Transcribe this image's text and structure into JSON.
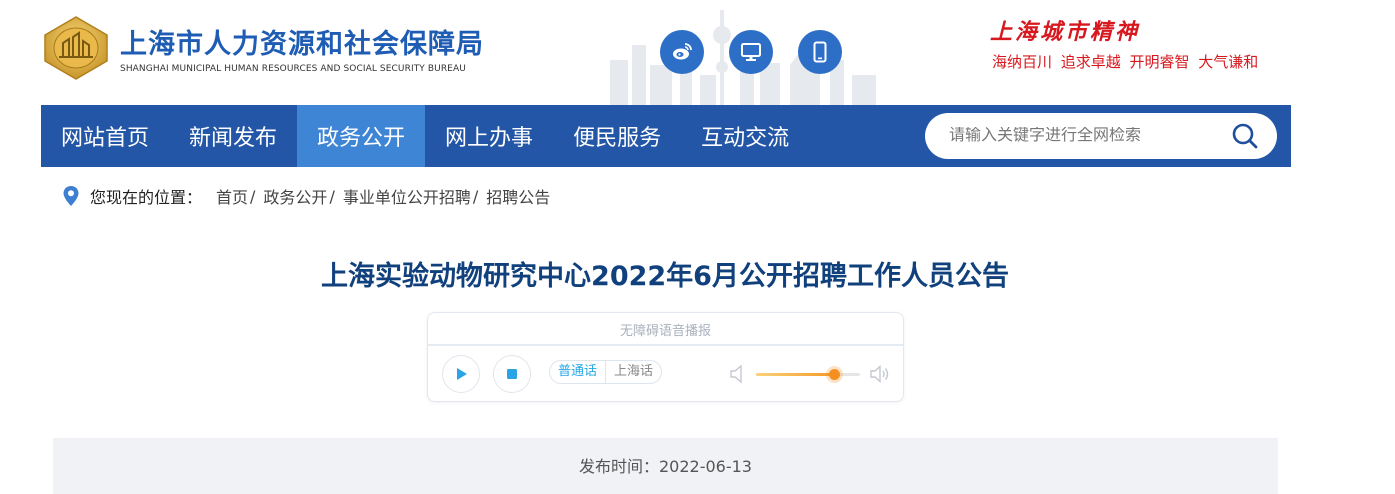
{
  "header": {
    "site_title": "上海市人力资源和社会保障局",
    "site_subtitle": "SHANGHAI MUNICIPAL HUMAN RESOURCES AND SOCIAL SECURITY BUREAU",
    "icons": [
      "weibo-icon",
      "desktop-icon",
      "mobile-icon"
    ],
    "spirit_title": "上海城市精神",
    "spirit_words": "海纳百川 追求卓越 开明睿智 大气谦和"
  },
  "nav": {
    "items": [
      "网站首页",
      "新闻发布",
      "政务公开",
      "网上办事",
      "便民服务",
      "互动交流"
    ],
    "active_index": 2,
    "search_placeholder": "请输入关键字进行全网检索"
  },
  "breadcrumb": {
    "label": "您现在的位置：",
    "items": [
      "首页",
      "政务公开",
      "事业单位公开招聘",
      "招聘公告"
    ],
    "separator": "/"
  },
  "article": {
    "title": "上海实验动物研究中心2022年6月公开招聘工作人员公告"
  },
  "player": {
    "title": "无障碍语音播报",
    "languages": [
      "普通话",
      "上海话"
    ],
    "active_language": "普通话",
    "volume": 0.75
  },
  "publish": {
    "text": "发布时间：2022-06-13"
  },
  "colors": {
    "brand_blue": "#2356a7",
    "nav_active": "#3f85d6",
    "title_blue": "#11417d",
    "spirit_red": "#d7191f",
    "accent_orange": "#f58f1f",
    "lang_active": "#27a7e6"
  }
}
